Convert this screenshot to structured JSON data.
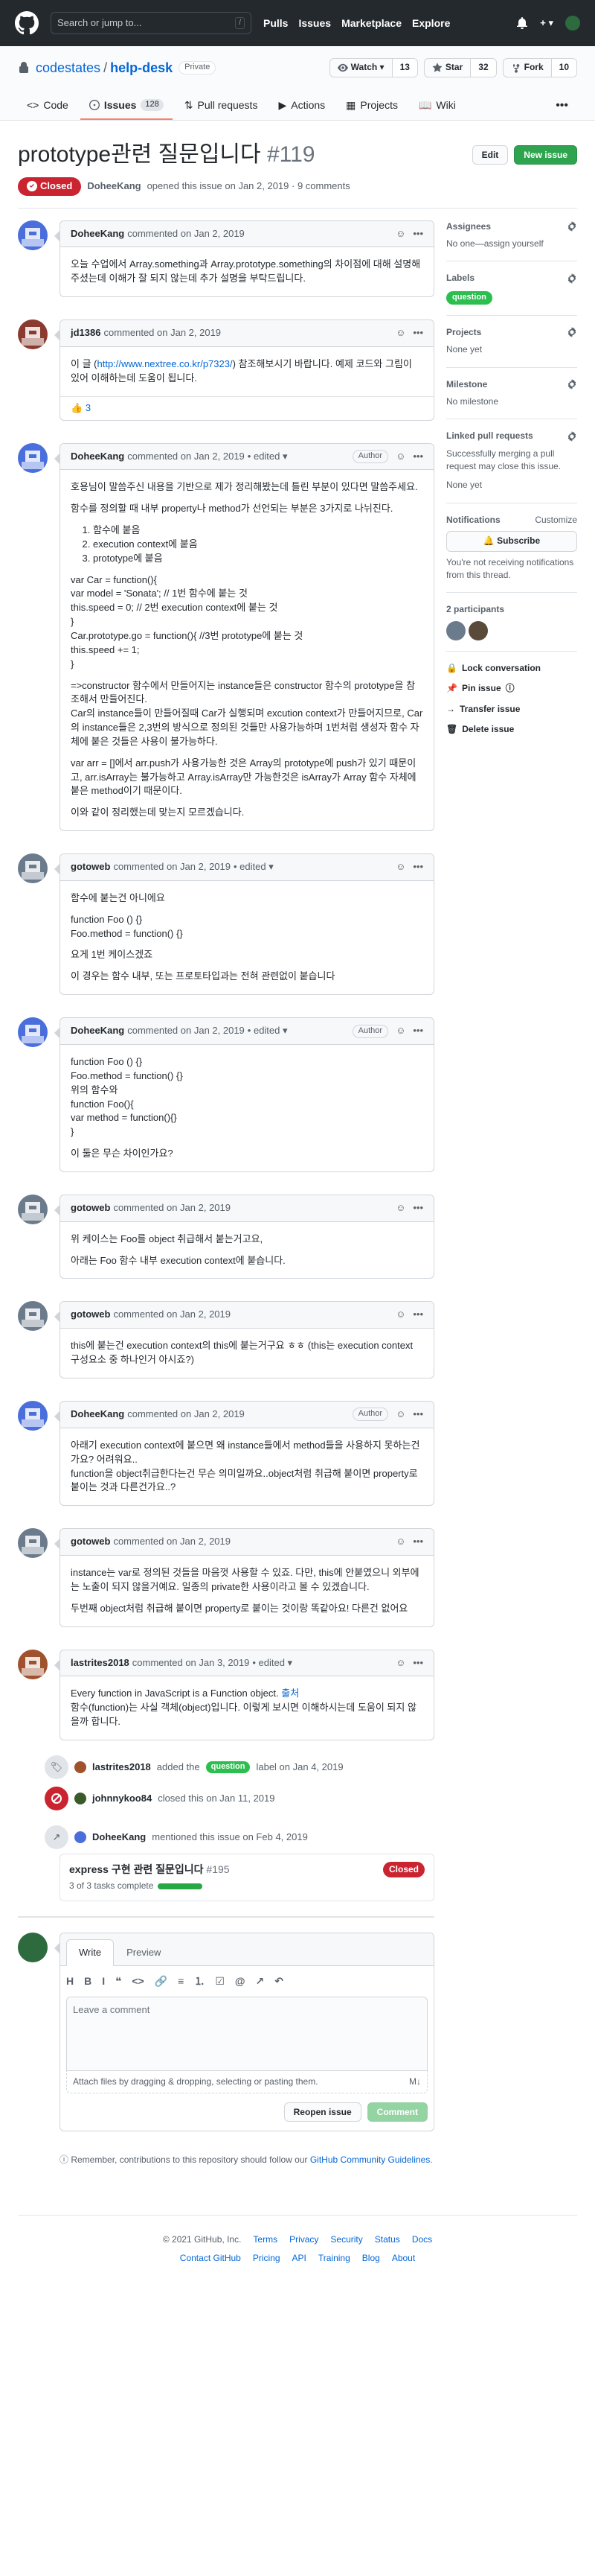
{
  "header": {
    "search_placeholder": "Search or jump to...",
    "slash": "/",
    "nav": [
      "Pulls",
      "Issues",
      "Marketplace",
      "Explore"
    ],
    "plus": "+ ▾"
  },
  "repo": {
    "owner": "codestates",
    "slash": "/",
    "name": "help-desk",
    "visibility": "Private",
    "watch_label": "Watch ▾",
    "watch_count": "13",
    "star_label": "Star",
    "star_count": "32",
    "fork_label": "Fork",
    "fork_count": "10",
    "tabs": [
      {
        "label": "Code",
        "icon": "code-icon"
      },
      {
        "label": "Issues",
        "icon": "issue-icon",
        "count": "128"
      },
      {
        "label": "Pull requests",
        "icon": "pr-icon"
      },
      {
        "label": "Actions",
        "icon": "play-icon"
      },
      {
        "label": "Projects",
        "icon": "project-icon"
      },
      {
        "label": "Wiki",
        "icon": "book-icon"
      }
    ],
    "more": "•••"
  },
  "issue": {
    "title": "prototype관련 질문입니다",
    "number": "#119",
    "edit_label": "Edit",
    "new_issue_label": "New issue",
    "state": "Closed",
    "author": "DoheeKang",
    "meta": "opened this issue on Jan 2, 2019 · 9 comments"
  },
  "comments": [
    {
      "author": "DoheeKang",
      "when": "commented on Jan 2, 2019",
      "avatar": "#4a6fdc",
      "edited": "",
      "role": "",
      "body": [
        "오늘 수업에서 Array.something과 Array.prototype.something의 차이점에 대해 설명해주셨는데 이해가 잘 되지 않는데 추가 설명을 부탁드립니다."
      ]
    },
    {
      "author": "jd1386",
      "when": "commented on Jan 2, 2019",
      "avatar": "#8b3a2f",
      "edited": "",
      "role": "",
      "body_parts": [
        "이 글 (",
        "http://www.nextree.co.kr/p7323/",
        ") 참조해보시기 바랍니다. 예제 코드와 그림이 있어 이해하는데 도움이 됩니다."
      ],
      "reaction_emoji": "👍",
      "reaction_count": "3"
    },
    {
      "author": "DoheeKang",
      "when": "commented on Jan 2, 2019",
      "avatar": "#4a6fdc",
      "edited": "• edited ▾",
      "role": "Author",
      "intro": [
        "호용님이 말씀주신 내용을 기반으로 제가 정리해봤는데 틀린 부분이 있다면 말씀주세요.",
        "함수를 정의할 때 내부 property나 method가 선언되는 부분은 3가지로 나뉘진다."
      ],
      "list": [
        "함수에 붙음",
        "execution context에 붙음",
        "prototype에 붙음"
      ],
      "code": "var Car = function(){\nvar model = 'Sonata'; // 1번 함수에 붙는 것\nthis.speed = 0; // 2번 execution context에 붙는 것\n}\nCar.prototype.go = function(){ //3번 prototype에 붙는 것\nthis.speed += 1;\n}",
      "outro": [
        "=>constructor 함수에서 만들어지는 instance들은 constructor 함수의 prototype을 참조해서 만들어진다.\nCar의 instance들이 만들어질때 Car가 실행되며 excution context가 만들어지므로, Car의 instance들은 2,3번의 방식으로 정의된 것들만 사용가능하며 1번처럼 생성자 함수 자체에 붙은 것들은 사용이 불가능하다.",
        "var arr = []에서 arr.push가 사용가능한 것은 Array의 prototype에 push가 있기 때문이고, arr.isArray는 불가능하고 Array.isArray만 가능한것은 isArray가 Array 함수 자체에 붙은 method이기 때문이다.",
        "이와 같이 정리했는데 맞는지 모르겠습니다."
      ]
    },
    {
      "author": "gotoweb",
      "when": "commented on Jan 2, 2019",
      "avatar": "#6b7b8c",
      "edited": "• edited ▾",
      "role": "",
      "body": [
        "함수에 붙는건 아니에요",
        "function Foo () {}\nFoo.method = function() {}",
        "요게 1번 케이스겠죠",
        "이 경우는 함수 내부, 또는 프로토타입과는 전혀 관련없이 붙습니다"
      ]
    },
    {
      "author": "DoheeKang",
      "when": "commented on Jan 2, 2019",
      "avatar": "#4a6fdc",
      "edited": "• edited ▾",
      "role": "Author",
      "body": [
        "function Foo () {}\nFoo.method = function() {}\n위의 함수와\nfunction Foo(){\nvar method = function(){}\n}",
        "이 둘은 무슨 차이인가요?"
      ]
    },
    {
      "author": "gotoweb",
      "when": "commented on Jan 2, 2019",
      "avatar": "#6b7b8c",
      "edited": "",
      "role": "",
      "body": [
        "위 케이스는 Foo를 object 취급해서 붙는거고요,",
        "아래는 Foo 함수 내부 execution context에 붙습니다."
      ]
    },
    {
      "author": "gotoweb",
      "when": "commented on Jan 2, 2019",
      "avatar": "#6b7b8c",
      "edited": "",
      "role": "",
      "body": [
        "this에 붙는건 execution context의 this에 붙는거구요 ㅎㅎ (this는 execution context 구성요소 중 하나인거 아시죠?)"
      ]
    },
    {
      "author": "DoheeKang",
      "when": "commented on Jan 2, 2019",
      "avatar": "#4a6fdc",
      "edited": "",
      "role": "Author",
      "body": [
        "아래기 execution context에 붙으면 왜 instance들에서 method들을 사용하지 못하는건가요? 어려워요..\nfunction을 object취급한다는건 무슨 의미일까요..object처럼 취급해 붙이면 property로 붙이는 것과 다른건가요..?"
      ]
    },
    {
      "author": "gotoweb",
      "when": "commented on Jan 2, 2019",
      "avatar": "#6b7b8c",
      "edited": "",
      "role": "",
      "body": [
        "instance는 var로 정의된 것들을 마음껏 사용할 수 있죠. 다만, this에 안붙였으니 외부에는 노출이 되지 않을거예요. 일종의 private한 사용이라고 볼 수 있겠습니다.",
        "두번째 object처럼 취급해 붙이면 property로 붙이는 것이랑 똑같아요! 다른건 없어요"
      ]
    },
    {
      "author": "lastrites2018",
      "when": "commented on Jan 3, 2019",
      "avatar": "#a0522d",
      "edited": "• edited ▾",
      "role": "",
      "body_parts": [
        "Every function in JavaScript is a Function object. ",
        "출처",
        "\n함수(function)는 사실 객체(object)입니다. 이렇게 보시면 이해하시는데 도움이 되지 않을까 합니다."
      ]
    }
  ],
  "events": {
    "labeled": {
      "actor": "lastrites2018",
      "text_before": "added the",
      "label": "question",
      "text_after": "label on Jan 4, 2019"
    },
    "closed": {
      "actor": "johnnykoo84",
      "text": "closed this on Jan 11, 2019"
    },
    "mention": {
      "actor": "DoheeKang",
      "text": "mentioned this issue on Feb 4, 2019",
      "title": "express 구현 관련 질문입니다",
      "number": "#195",
      "tasks": "3 of 3 tasks complete",
      "progress": 1.0,
      "state": "Closed"
    }
  },
  "composer": {
    "write_tab": "Write",
    "preview_tab": "Preview",
    "placeholder": "Leave a comment",
    "attach_text": "Attach files by dragging & dropping, selecting or pasting them.",
    "markdown_label": "M↓",
    "reopen_label": "Reopen issue",
    "comment_label": "Comment",
    "remember_prefix": "Remember, contributions to this repository should follow our ",
    "remember_link": "GitHub Community Guidelines",
    "remember_suffix": "."
  },
  "sidebar": {
    "assignees_h": "Assignees",
    "assignees_v": "No one—assign yourself",
    "labels_h": "Labels",
    "label": "question",
    "projects_h": "Projects",
    "projects_v": "None yet",
    "milestone_h": "Milestone",
    "milestone_v": "No milestone",
    "linked_h": "Linked pull requests",
    "linked_v": "Successfully merging a pull request may close this issue.",
    "linked_none": "None yet",
    "notif_h": "Notifications",
    "notif_customize": "Customize",
    "subscribe": "Subscribe",
    "notif_v": "You're not receiving notifications from this thread.",
    "participants_h": "2 participants",
    "actions": [
      "Lock conversation",
      "Pin issue",
      "Transfer issue",
      "Delete issue"
    ]
  },
  "footer": {
    "copyright": "© 2021 GitHub, Inc.",
    "row1": [
      "Terms",
      "Privacy",
      "Security",
      "Status",
      "Docs"
    ],
    "row2": [
      "Contact GitHub",
      "Pricing",
      "API",
      "Training",
      "Blog",
      "About"
    ]
  },
  "colors": {
    "closed": "#cb2431",
    "green": "#2ea44f",
    "label_question": "#2cbe4e",
    "link": "#0366d6"
  }
}
